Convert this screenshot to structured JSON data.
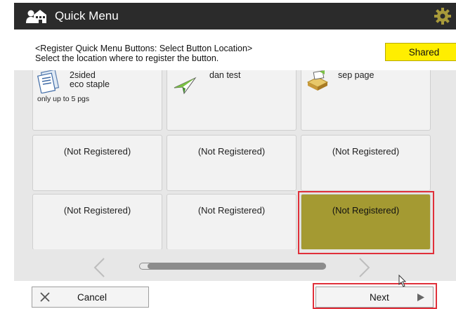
{
  "title_bar": {
    "title": "Quick Menu",
    "home_icon": "home-building-icon",
    "settings_icon": "gear-icon"
  },
  "header": {
    "instruction_line1": "<Register Quick Menu Buttons: Select Button Location>",
    "instruction_line2": "Select the location where to register the button.",
    "shared_label": "Shared",
    "shared_color": "#ffee00"
  },
  "grid": {
    "tiles": [
      {
        "name_line1": "2sided",
        "name_line2": "eco staple",
        "sub": "only up to 5 pgs",
        "icon": "copy-document-icon"
      },
      {
        "name_line1": "dan test",
        "name_line2": "",
        "sub": "",
        "icon": "paper-plane-icon"
      },
      {
        "name_line1": "sep page",
        "name_line2": "",
        "sub": "",
        "icon": "tray-feed-icon"
      },
      {
        "label": "(Not Registered)"
      },
      {
        "label": "(Not Registered)"
      },
      {
        "label": "(Not Registered)"
      },
      {
        "label": "(Not Registered)"
      },
      {
        "label": "(Not Registered)"
      },
      {
        "label": "(Not Registered)",
        "selected": true
      }
    ],
    "selected_color": "#a49a32",
    "highlight_color": "#e0303a"
  },
  "navigation": {
    "prev_icon": "chevron-left-icon",
    "next_icon": "chevron-right-icon"
  },
  "footer": {
    "cancel_label": "Cancel",
    "next_label": "Next",
    "cancel_icon": "close-icon",
    "next_icon": "play-icon"
  }
}
